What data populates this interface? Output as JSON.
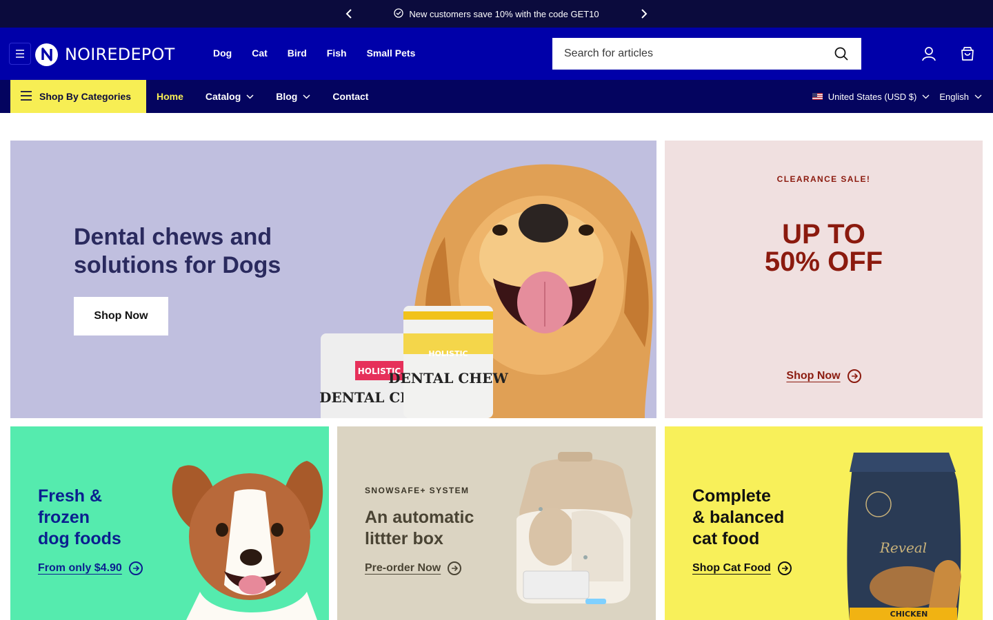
{
  "announcement": {
    "message": "New customers save 10% with the code GET10"
  },
  "header": {
    "logo_text": "NOIREDEPOT",
    "primary_nav": [
      "Dog",
      "Cat",
      "Bird",
      "Fish",
      "Small Pets"
    ],
    "search_placeholder": "Search for articles"
  },
  "subnav": {
    "categories_label": "Shop By Categories",
    "links": [
      {
        "label": "Home",
        "active": true
      },
      {
        "label": "Catalog",
        "dropdown": true
      },
      {
        "label": "Blog",
        "dropdown": true
      },
      {
        "label": "Contact"
      }
    ],
    "country": "United States (USD $)",
    "language": "English"
  },
  "hero": {
    "title": "Dental chews and solutions for Dogs",
    "button": "Shop Now",
    "packs": [
      "HOLISTIC",
      "DENTAL CHEW",
      "HOLISTIC",
      "DENTAL CHEW"
    ]
  },
  "promo": {
    "kicker": "CLEARANCE SALE!",
    "line1": "UP TO",
    "line2": "50% OFF",
    "cta": "Shop Now"
  },
  "cards": [
    {
      "title_lines": [
        "Fresh &",
        "frozen",
        "dog foods"
      ],
      "cta": "From only $4.90"
    },
    {
      "kicker": "SNOWSAFE+ SYSTEM",
      "title_lines": [
        "An automatic",
        "littter box"
      ],
      "cta": "Pre-order Now"
    },
    {
      "title_lines": [
        "Complete",
        "& balanced",
        "cat food"
      ],
      "cta": "Shop Cat Food",
      "bag_brand": "Reveal",
      "bag_flavor": "CHICKEN"
    }
  ],
  "colors": {
    "announce_bg": "#0b0b3d",
    "header_bg": "#0000a9",
    "subnav_bg": "#04045f",
    "accent_yellow": "#f7ee54",
    "hero_bg": "#c0bfdf",
    "promo_bg": "#f0e0e0",
    "promo_text": "#8b1a0e",
    "card_green": "#55ebae",
    "card_beige": "#dbd4c2",
    "card_yellow": "#f8f05a"
  },
  "icons": [
    "chevron-left-icon",
    "chevron-right-icon",
    "check-badge-icon",
    "menu-icon",
    "search-icon",
    "user-icon",
    "cart-icon",
    "chevron-down-icon",
    "arrow-circle-right-icon",
    "us-flag-icon"
  ]
}
